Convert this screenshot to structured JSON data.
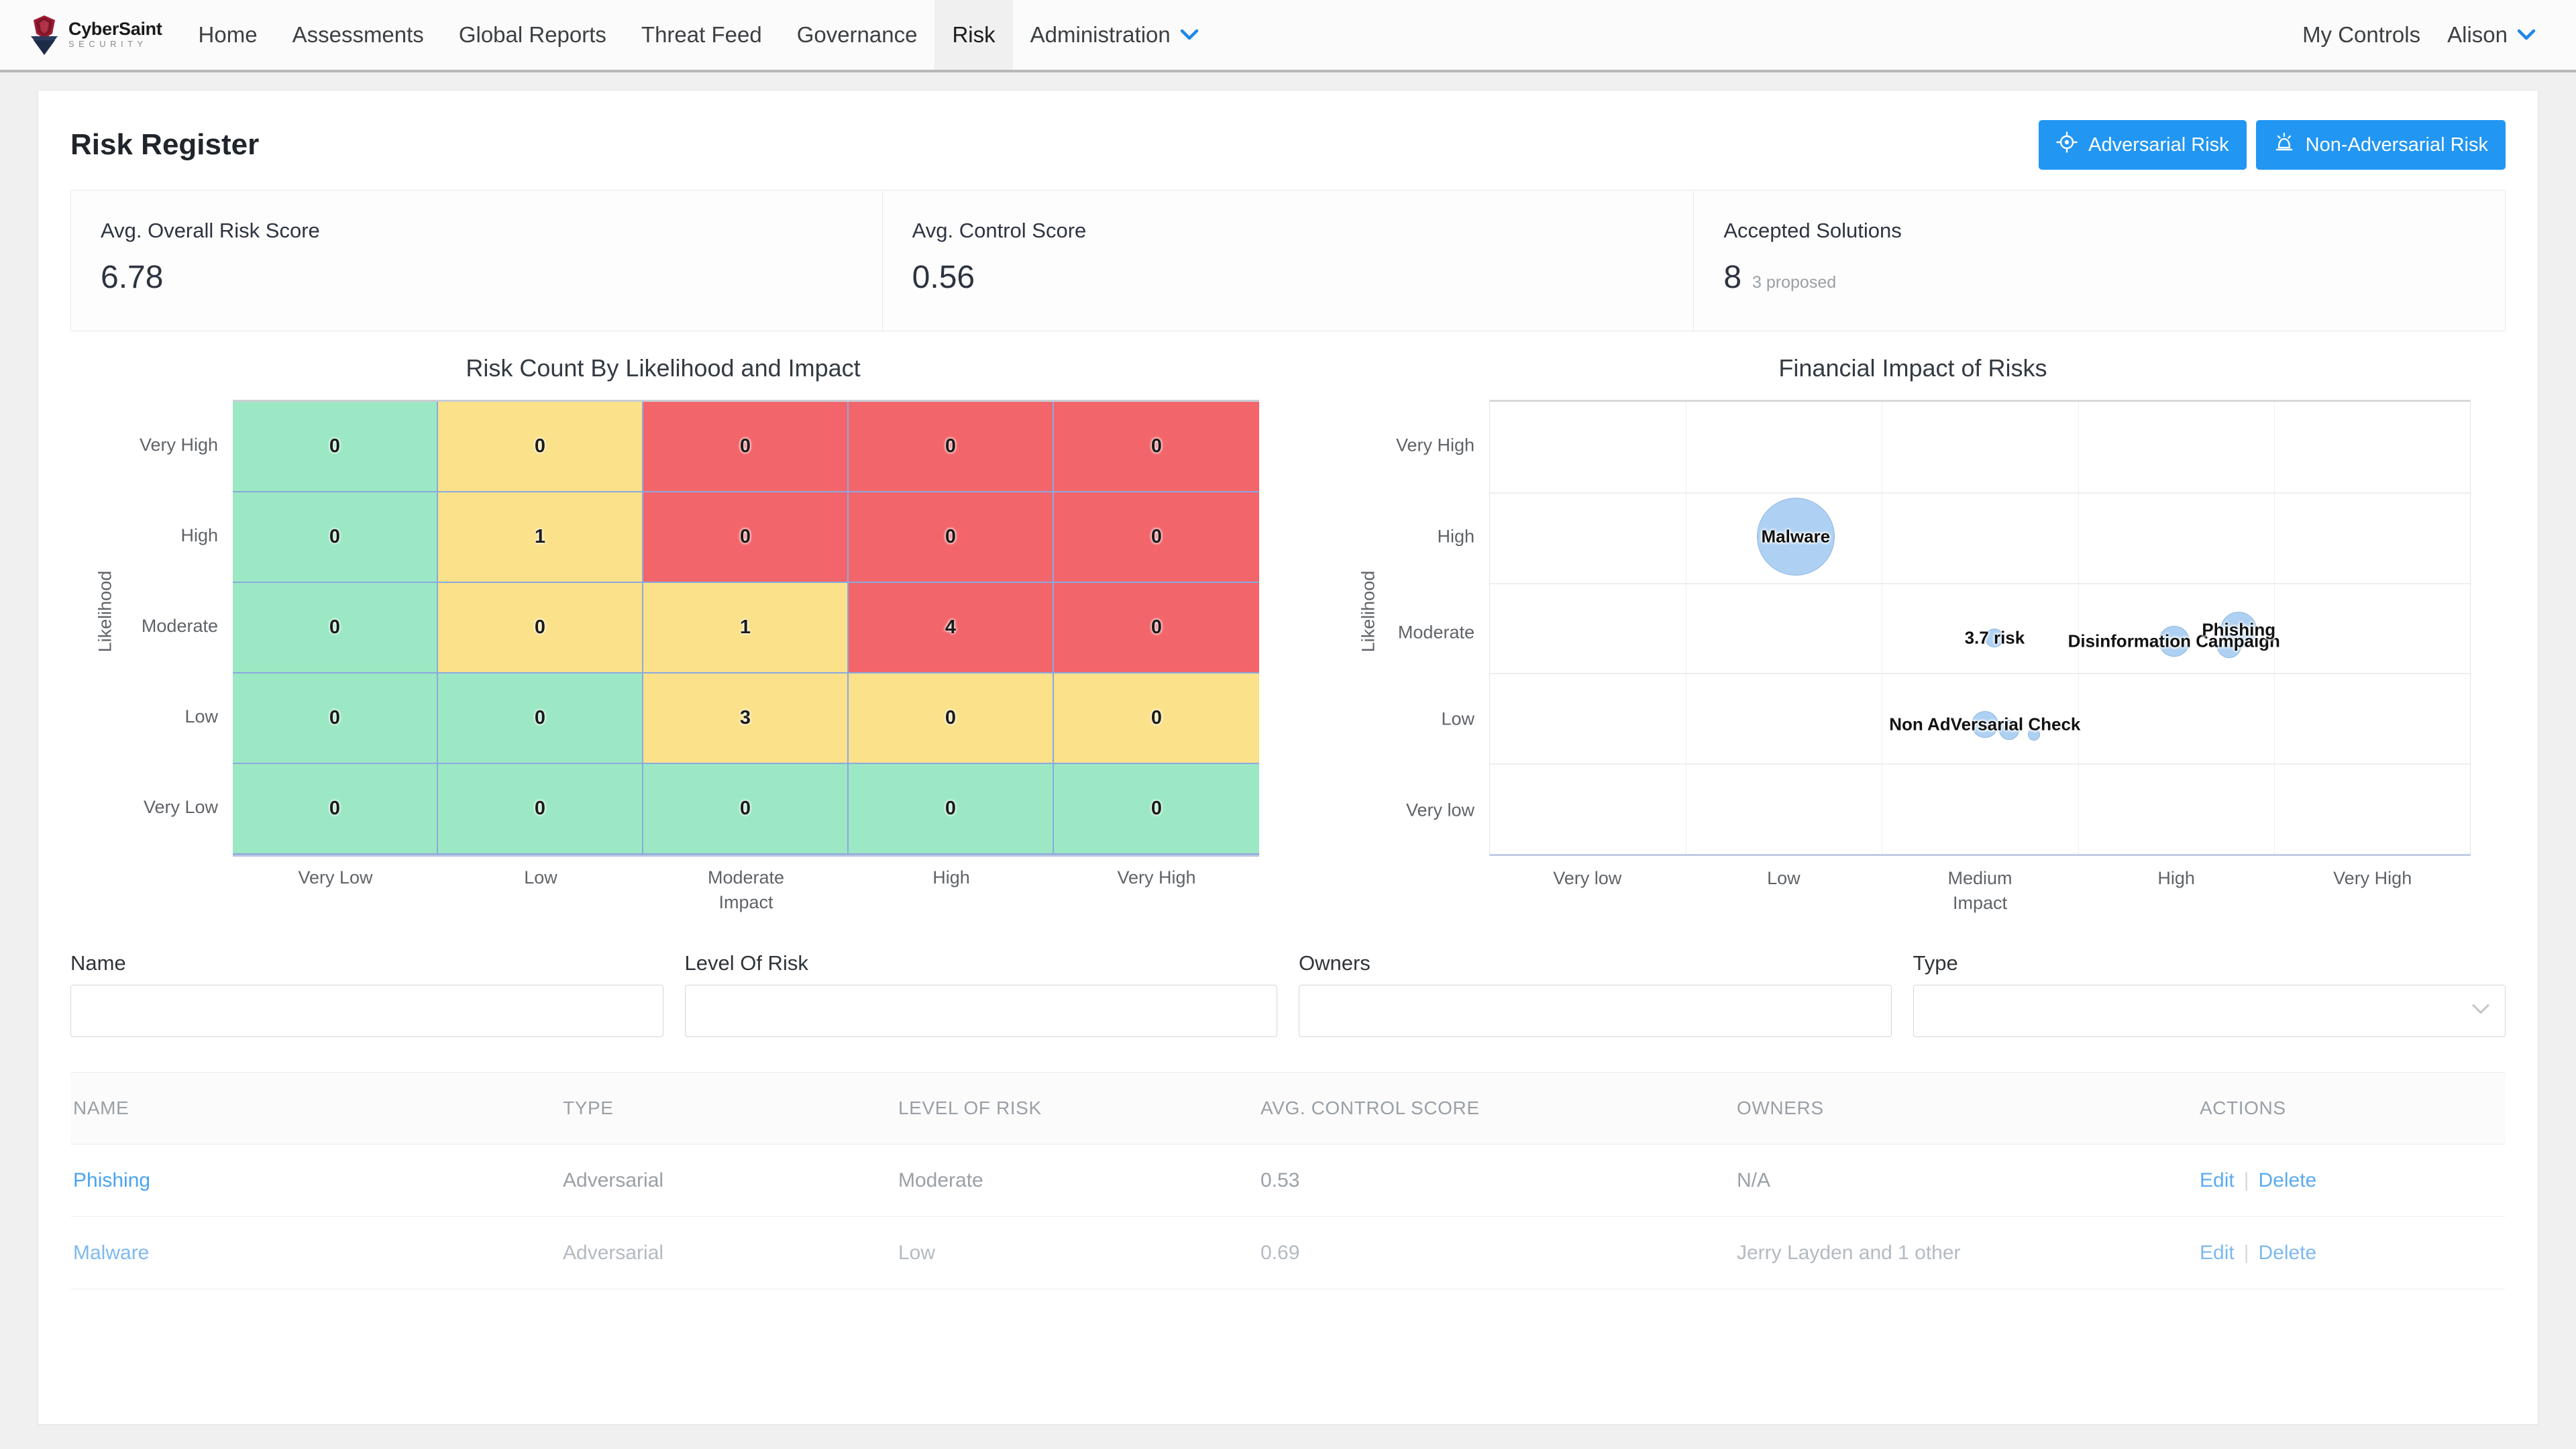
{
  "nav": {
    "brand": {
      "name": "CyberSaint",
      "sub": "SECURITY",
      "logo_icon": "shield-logo-icon"
    },
    "items": [
      {
        "label": "Home",
        "active": false
      },
      {
        "label": "Assessments",
        "active": false
      },
      {
        "label": "Global Reports",
        "active": false
      },
      {
        "label": "Threat Feed",
        "active": false
      },
      {
        "label": "Governance",
        "active": false
      },
      {
        "label": "Risk",
        "active": true
      },
      {
        "label": "Administration",
        "active": false,
        "caret": true
      }
    ],
    "right": [
      {
        "label": "My Controls",
        "caret": false
      },
      {
        "label": "Alison",
        "caret": true
      }
    ]
  },
  "header": {
    "title": "Risk Register",
    "buttons": [
      {
        "label": "Adversarial Risk",
        "icon": "crosshair-target-icon",
        "color": "#2196f3"
      },
      {
        "label": "Non-Adversarial Risk",
        "icon": "siren-alarm-icon",
        "color": "#2196f3"
      }
    ]
  },
  "kpis": [
    {
      "label": "Avg. Overall Risk Score",
      "value": "6.78",
      "sub": ""
    },
    {
      "label": "Avg. Control Score",
      "value": "0.56",
      "sub": ""
    },
    {
      "label": "Accepted Solutions",
      "value": "8",
      "sub": "3 proposed"
    }
  ],
  "chart_data": [
    {
      "type": "heatmap",
      "title": "Risk Count By Likelihood and Impact",
      "xlabel": "Impact",
      "ylabel": "Likelihood",
      "x_categories": [
        "Very Low",
        "Low",
        "Moderate",
        "High",
        "Very High"
      ],
      "y_categories": [
        "Very High",
        "High",
        "Moderate",
        "Low",
        "Very Low"
      ],
      "values": [
        [
          0,
          0,
          0,
          0,
          0
        ],
        [
          0,
          1,
          0,
          0,
          0
        ],
        [
          0,
          0,
          1,
          4,
          0
        ],
        [
          0,
          0,
          3,
          0,
          0
        ],
        [
          0,
          0,
          0,
          0,
          0
        ]
      ],
      "cell_levels": [
        [
          "g",
          "y",
          "r",
          "r",
          "r"
        ],
        [
          "g",
          "y",
          "r",
          "r",
          "r"
        ],
        [
          "g",
          "y",
          "y",
          "r",
          "r"
        ],
        [
          "g",
          "g",
          "y",
          "y",
          "y"
        ],
        [
          "g",
          "g",
          "g",
          "g",
          "g"
        ]
      ],
      "colors": {
        "g": "#9de8c4",
        "y": "#fae18a",
        "r": "#f2656a"
      },
      "grid": true
    },
    {
      "type": "scatter",
      "subtype": "bubble",
      "title": "Financial Impact of Risks",
      "xlabel": "Impact",
      "ylabel": "Likelihood",
      "x_categories": [
        "Very low",
        "Low",
        "Medium",
        "High",
        "Very High"
      ],
      "y_categories": [
        "Very High",
        "High",
        "Moderate",
        "Low",
        "Very low"
      ],
      "bubble_color": "#9ac5f0",
      "points": [
        {
          "label": "Malware",
          "x_pct": 31.2,
          "y_pct": 29.8,
          "r": 58,
          "show_label": true
        },
        {
          "label": "3.7 risk",
          "x_pct": 51.5,
          "y_pct": 52.2,
          "r": 14,
          "show_label": true
        },
        {
          "label": "Disinformation Campaign",
          "x_pct": 69.8,
          "y_pct": 53.0,
          "r": 23,
          "show_label": true
        },
        {
          "label": "Phishing",
          "x_pct": 76.4,
          "y_pct": 50.5,
          "r": 27,
          "show_label": true
        },
        {
          "label": "",
          "x_pct": 75.4,
          "y_pct": 54.0,
          "r": 18,
          "show_label": false
        },
        {
          "label": "Non AdVersarial Check",
          "x_pct": 50.5,
          "y_pct": 71.4,
          "r": 20,
          "show_label": true
        },
        {
          "label": "",
          "x_pct": 53.0,
          "y_pct": 72.5,
          "r": 15,
          "show_label": false
        },
        {
          "label": "",
          "x_pct": 55.5,
          "y_pct": 73.6,
          "r": 9,
          "show_label": false
        }
      ]
    }
  ],
  "filters": [
    {
      "label": "Name",
      "value": "",
      "placeholder": "",
      "type": "text"
    },
    {
      "label": "Level Of Risk",
      "value": "",
      "placeholder": "",
      "type": "text"
    },
    {
      "label": "Owners",
      "value": "",
      "placeholder": "",
      "type": "text"
    },
    {
      "label": "Type",
      "value": "",
      "placeholder": "",
      "type": "select"
    }
  ],
  "table": {
    "columns": [
      "NAME",
      "TYPE",
      "LEVEL OF RISK",
      "AVG. CONTROL SCORE",
      "OWNERS",
      "ACTIONS"
    ],
    "rows": [
      {
        "name": "Phishing",
        "type": "Adversarial",
        "level_of_risk": "Moderate",
        "avg_control_score": "0.53",
        "owners": "N/A",
        "actions": {
          "edit": "Edit",
          "separator": "|",
          "delete": "Delete"
        }
      },
      {
        "name": "Malware",
        "type": "Adversarial",
        "level_of_risk": "Low",
        "avg_control_score": "0.69",
        "owners": "Jerry Layden and 1 other",
        "actions": {
          "edit": "Edit",
          "separator": "|",
          "delete": "Delete"
        }
      }
    ]
  }
}
